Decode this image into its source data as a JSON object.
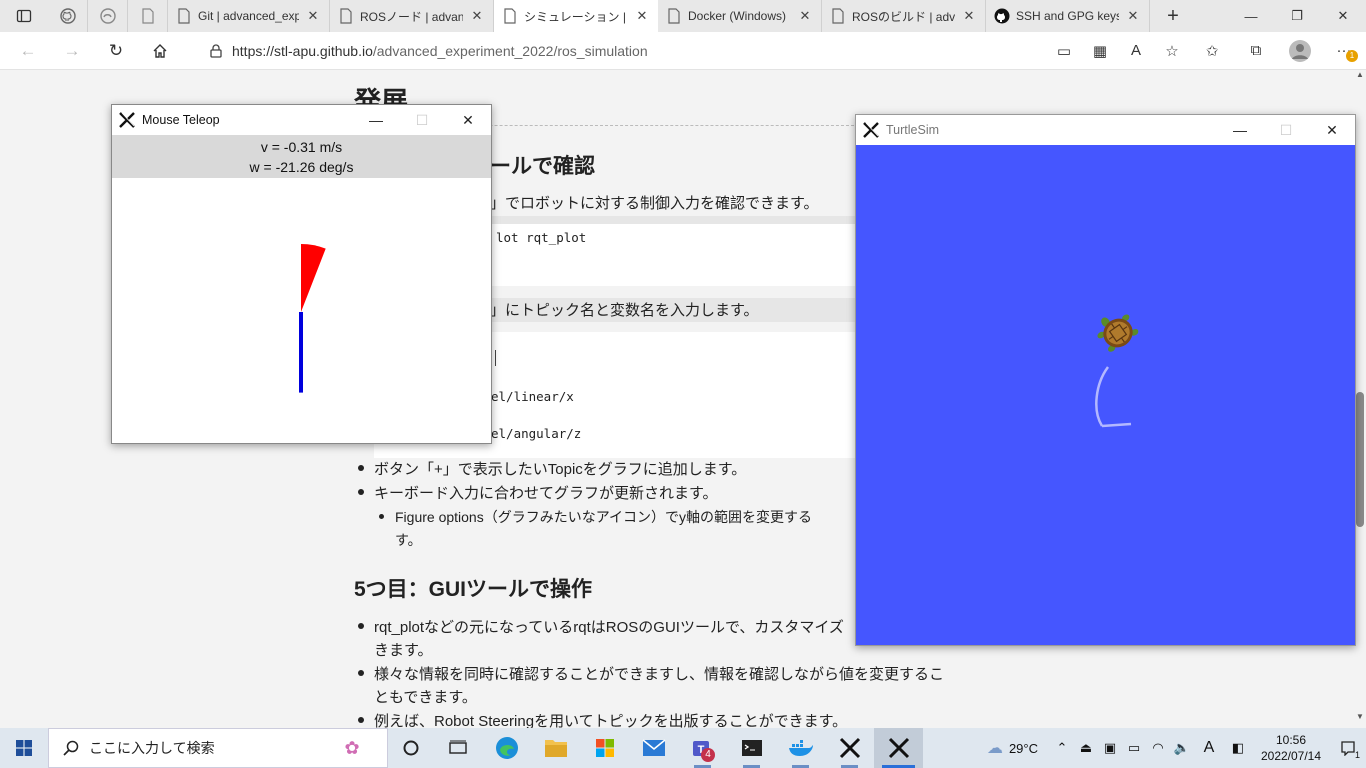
{
  "browser": {
    "tabs": [
      {
        "icon": "github-icon",
        "label": "",
        "pinned": true
      },
      {
        "icon": "edge-icon",
        "label": "",
        "pinned": true
      },
      {
        "icon": "page-icon",
        "label": "",
        "pinned": true
      },
      {
        "icon": "page-icon",
        "label": "Git | advanced_exp",
        "active": false
      },
      {
        "icon": "page-icon",
        "label": "ROSノード | advance",
        "active": false
      },
      {
        "icon": "page-icon",
        "label": "シミュレーション | adv",
        "active": true
      },
      {
        "icon": "page-icon",
        "label": "Docker (Windows)",
        "active": false
      },
      {
        "icon": "page-icon",
        "label": "ROSのビルド | advan",
        "active": false
      },
      {
        "icon": "github-icon",
        "label": "SSH and GPG keys",
        "active": false
      }
    ],
    "new_tab": "+",
    "url_host": "https://stl-apu.github.io",
    "url_path": "/advanced_experiment_2022/ros_simulation",
    "notification_badge": "1"
  },
  "page": {
    "heading_partial": "発展",
    "h2_partial": "ールで確認",
    "line1": "」でロボットに対する制御入力を確認できます。",
    "code1": "lot rqt_plot",
    "line2": "」にトピック名と変数名を入力します。",
    "code2_line1": "el/linear/x",
    "code2_line2": "el/angular/z",
    "bullet1": "ボタン「+」で表示したいTopicをグラフに追加します。",
    "bullet2": "キーボード入力に合わせてグラフが更新されます。",
    "sub_bullet_l1": "Figure options（グラフみたいなアイコン）でy軸の範囲を変更する",
    "sub_bullet_l2": "す。",
    "h2_5": "5つ目：GUIツールで操作",
    "b5_1a": "rqt_plotなどの元になっているrqtはROSのGUIツールで、カスタマイズ",
    "b5_1b": "きます。",
    "b5_2a": "様々な情報を同時に確認することができますし、情報を確認しながら値を変更するこ",
    "b5_2b": "ともできます。",
    "b5_3": "例えば、Robot Steeringを用いてトピックを出版することができます。"
  },
  "teleop": {
    "title": "Mouse Teleop",
    "v_text": "v = -0.31 m/s",
    "w_text": "w = -21.26 deg/s",
    "linear_velocity_mps": -0.31,
    "angular_velocity_degps": -21.26,
    "linear_color": "#0000dd",
    "angular_color": "#ff0000"
  },
  "turtlesim": {
    "title": "TurtleSim",
    "background_color": "#4556ff",
    "trail_color": "#b3b8ff"
  },
  "taskbar": {
    "search_placeholder": "ここに入力して検索",
    "temperature": "29°C",
    "time": "10:56",
    "date": "2022/07/14",
    "ime": "A",
    "teams_badge": "4",
    "notification_count": "1"
  }
}
